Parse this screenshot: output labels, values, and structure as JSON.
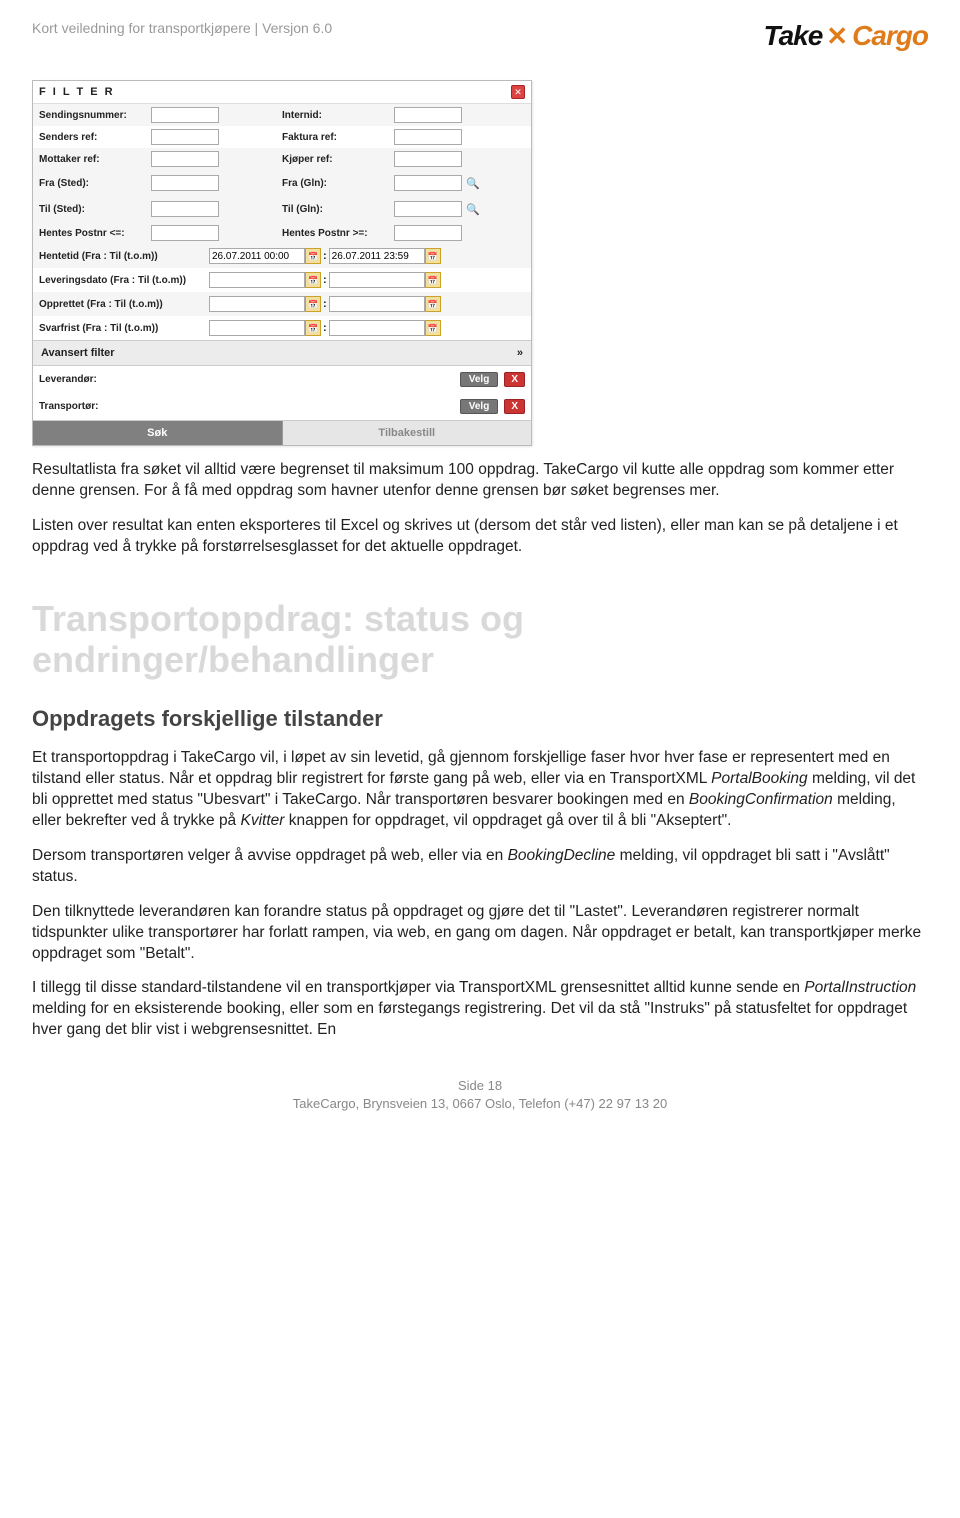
{
  "header": {
    "doc_title": "Kort veiledning for transportkjøpere | Versjon 6.0",
    "logo_take": "Take",
    "logo_cargo": "Cargo"
  },
  "filter": {
    "title": "F I L T E R",
    "rows_top": [
      {
        "l1": "Sendingsnummer:",
        "l2": "Internid:"
      },
      {
        "l1": "Senders ref:",
        "l2": "Faktura ref:"
      },
      {
        "l1": "Mottaker ref:",
        "l2": "Kjøper ref:"
      }
    ],
    "rows_gln": [
      {
        "l1": "Fra (Sted):",
        "l2": "Fra (Gln):"
      },
      {
        "l1": "Til (Sted):",
        "l2": "Til (Gln):"
      }
    ],
    "row_postnr": {
      "l1": "Hentes Postnr <=:",
      "l2": "Hentes Postnr >=:"
    },
    "rows_dates": [
      {
        "label": "Hentetid (Fra : Til (t.o.m))",
        "v1": "26.07.2011 00:00",
        "v2": "26.07.2011 23:59"
      },
      {
        "label": "Leveringsdato (Fra : Til (t.o.m))",
        "v1": "",
        "v2": ""
      },
      {
        "label": "Opprettet (Fra : Til (t.o.m))",
        "v1": "",
        "v2": ""
      },
      {
        "label": "Svarfrist (Fra : Til (t.o.m))",
        "v1": "",
        "v2": ""
      }
    ],
    "adv_label": "Avansert filter",
    "adv_chevron": "»",
    "adv_rows": [
      {
        "label": "Leverandør:"
      },
      {
        "label": "Transportør:"
      }
    ],
    "select_label": "Velg",
    "x_label": "X",
    "search": "Søk",
    "reset": "Tilbakestill"
  },
  "content": {
    "p1": "Resultatlista fra søket vil alltid være begrenset til maksimum 100 oppdrag. TakeCargo vil kutte alle oppdrag som kommer etter denne grensen. For å få med oppdrag som havner utenfor denne grensen bør søket begrenses mer.",
    "p2": "Listen over resultat kan enten eksporteres til Excel og skrives ut (dersom det står ved listen), eller man kan se på detaljene i et oppdrag ved å trykke på forstørrelsesglasset for det aktuelle oppdraget.",
    "h1a": "Transportoppdrag: status og",
    "h1b": "endringer/behandlinger",
    "h2": "Oppdragets forskjellige tilstander",
    "p3a": "Et transportoppdrag i TakeCargo vil, i løpet av sin levetid, gå gjennom forskjellige faser hvor hver fase er representert med en tilstand eller status. Når et oppdrag blir registrert for første gang på web, eller via en TransportXML ",
    "p3em1": "PortalBooking",
    "p3b": " melding, vil det bli opprettet med status \"Ubesvart\" i TakeCargo. Når transportøren besvarer bookingen med en ",
    "p3em2": "BookingConfirmation",
    "p3c": " melding, eller bekrefter ved å trykke på ",
    "p3em3": "Kvitter",
    "p3d": " knappen for oppdraget, vil oppdraget gå over til å bli \"Akseptert\".",
    "p4a": "Dersom transportøren velger å avvise oppdraget på web, eller via en ",
    "p4em": "BookingDecline",
    "p4b": " melding, vil oppdraget bli satt i \"Avslått\" status.",
    "p5": "Den tilknyttede leverandøren kan forandre status på oppdraget og gjøre det til \"Lastet\". Leverandøren registrerer normalt tidspunkter ulike transportører har forlatt rampen, via web, en gang om dagen. Når oppdraget er betalt, kan transportkjøper merke oppdraget som \"Betalt\".",
    "p6a": "I tillegg til disse standard-tilstandene vil en transportkjøper via TransportXML grensesnittet alltid kunne sende en ",
    "p6em": "PortalInstruction",
    "p6b": " melding for en eksisterende booking, eller som en førstegangs registrering. Det vil da stå \"Instruks\" på statusfeltet for oppdraget hver gang det blir vist i webgrensesnittet.  En"
  },
  "footer": {
    "line1": "Side 18",
    "line2": "TakeCargo, Brynsveien 13, 0667 Oslo, Telefon (+47)  22 97 13 20"
  }
}
